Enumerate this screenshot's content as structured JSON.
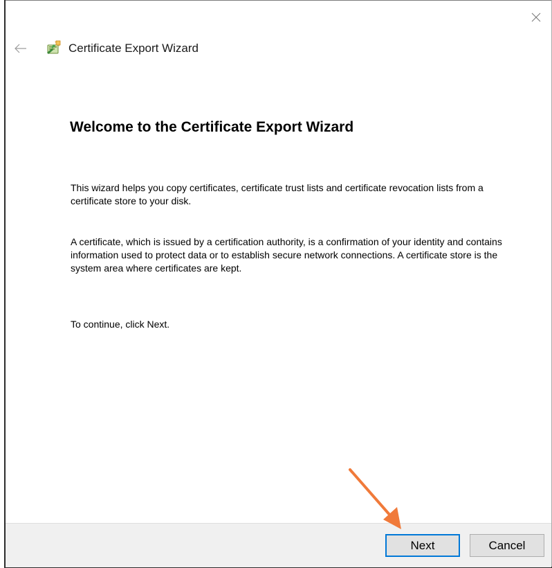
{
  "window": {
    "header_title": "Certificate Export Wizard",
    "close_icon": "close-icon",
    "back_icon": "back-arrow-icon",
    "header_icon": "certificate-icon"
  },
  "content": {
    "page_title": "Welcome to the Certificate Export Wizard",
    "paragraph_1": "This wizard helps you copy certificates, certificate trust lists and certificate revocation lists from a certificate store to your disk.",
    "paragraph_2": "A certificate, which is issued by a certification authority, is a confirmation of your identity and contains information used to protect data or to establish secure network connections. A certificate store is the system area where certificates are kept.",
    "paragraph_3": "To continue, click Next."
  },
  "footer": {
    "next_label": "Next",
    "cancel_label": "Cancel"
  },
  "colors": {
    "accent": "#0078d7",
    "annotation_arrow": "#f07a3a",
    "footer_bg": "#f0f0f0"
  }
}
